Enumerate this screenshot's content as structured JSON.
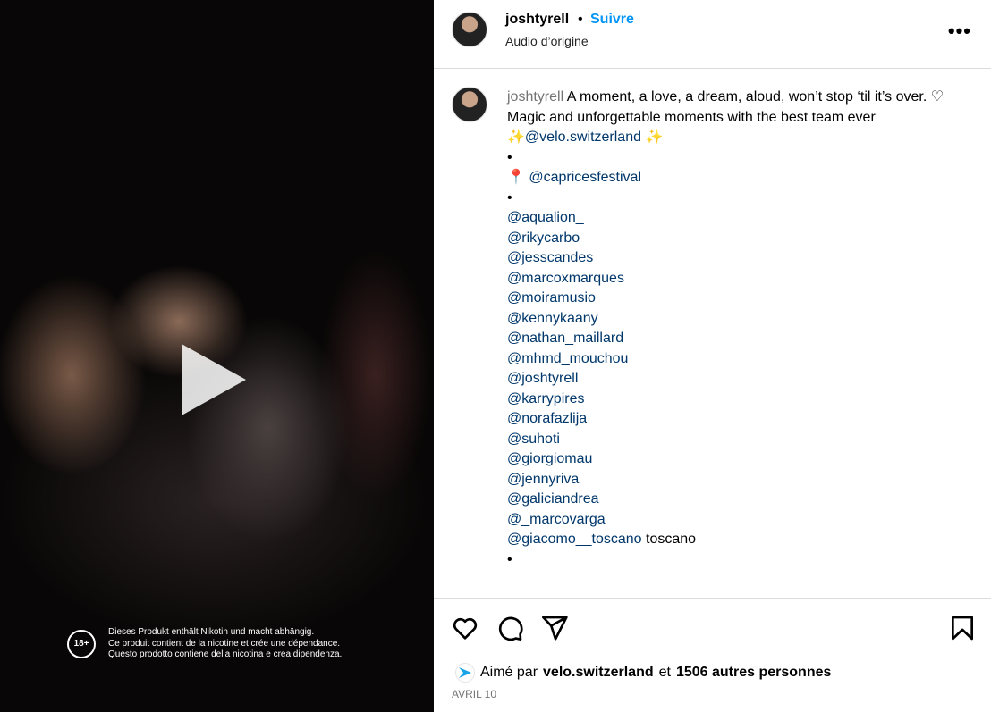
{
  "media": {
    "age_badge": "18+",
    "warning_lines": [
      "Dieses Produkt enthält Nikotin und macht abhängig.",
      "Ce produit contient de la nicotine et crée une dépendance.",
      "Questo prodotto contiene della nicotina e crea dipendenza."
    ]
  },
  "header": {
    "username": "joshtyrell",
    "separator": "•",
    "follow_label": "Suivre",
    "audio": "Audio d’origine",
    "more": "•••"
  },
  "caption": {
    "username": "joshtyrell",
    "line1": "A moment, a love, a dream, aloud, won’t stop ‘til it’s over. ♡",
    "line2": "Magic and unforgettable moments with the best team ever",
    "sparkle": "✨",
    "brand_mention": "@velo.switzerland",
    "bullet": "•",
    "pin": "📍",
    "festival_mention": "@capricesfestival",
    "mentions": [
      "@aqualion_",
      "@rikycarbo",
      "@jesscandes",
      "@marcoxmarques",
      "@moiramusio",
      "@kennykaany",
      "@nathan_maillard",
      "@mhmd_mouchou",
      "@joshtyrell",
      "@karrypires",
      "@norafazlija",
      "@suhoti",
      "@giorgiomau",
      "@jennyriva",
      "@galiciandrea",
      "@_marcovarga",
      "@giacomo__toscano"
    ],
    "last_suffix": " toscano"
  },
  "footer": {
    "liked_prefix": "Aimé par",
    "liked_user": "velo.switzerland",
    "liked_and": "et",
    "liked_count": "1506 autres personnes",
    "date": "AVRIL 10"
  }
}
